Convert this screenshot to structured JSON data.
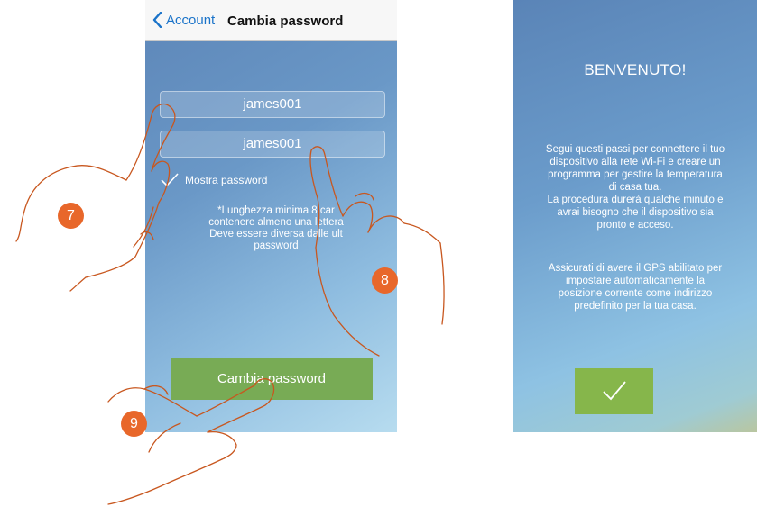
{
  "left_screen": {
    "back_label": "Account",
    "title": "Cambia password",
    "password_field_1": "james001",
    "password_field_2": "james001",
    "show_password_label": "Mostra password",
    "hint_lines": [
      "*Lunghezza minima 8 car",
      "contenere almeno una lettera",
      "Deve essere diversa dalle ult",
      "password"
    ],
    "submit_label": "Cambia password"
  },
  "right_screen": {
    "title": "BENVENUTO!",
    "paragraph_1_lines": [
      "Segui questi passi per connettere il tuo",
      "dispositivo alla rete Wi-Fi e creare un",
      "programma per gestire la temperatura",
      "di casa tua.",
      "La procedura durerà qualche minuto e",
      "avrai bisogno che il dispositivo sia",
      "pronto e acceso."
    ],
    "paragraph_2_lines": [
      "Assicurati di avere il GPS abilitato per",
      "impostare automaticamente la",
      "posizione corrente come indirizzo",
      "predefinito per la tua casa."
    ]
  },
  "markers": {
    "step_7": "7",
    "step_8": "8",
    "step_9": "9"
  },
  "colors": {
    "accent": "#e8672a",
    "button_green": "#78ab55",
    "link_blue": "#1a73c9"
  }
}
